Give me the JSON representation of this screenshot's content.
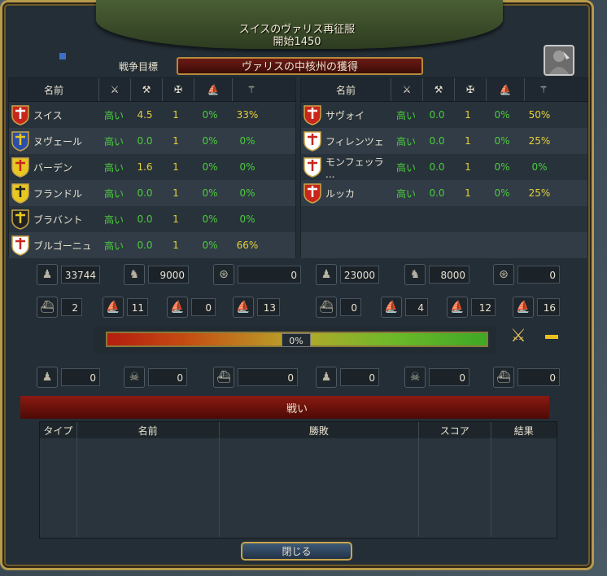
{
  "window": {
    "title": "スイスのヴァリス再征服",
    "subtitle": "開始1450",
    "goal_label": "戦争目標",
    "goal_value": "ヴァリスの中核州の獲得"
  },
  "table_headers": {
    "name": "名前"
  },
  "attackers": [
    {
      "name": "スイス",
      "v1": "高い",
      "v2": "4.5",
      "v3": "1",
      "v4": "0%",
      "v5": "33%"
    },
    {
      "name": "ヌヴェール",
      "v1": "高い",
      "v2": "0.0",
      "v3": "1",
      "v4": "0%",
      "v5": "0%"
    },
    {
      "name": "バーデン",
      "v1": "高い",
      "v2": "1.6",
      "v3": "1",
      "v4": "0%",
      "v5": "0%"
    },
    {
      "name": "フランドル",
      "v1": "高い",
      "v2": "0.0",
      "v3": "1",
      "v4": "0%",
      "v5": "0%"
    },
    {
      "name": "ブラバント",
      "v1": "高い",
      "v2": "0.0",
      "v3": "1",
      "v4": "0%",
      "v5": "0%"
    },
    {
      "name": "ブルゴーニュ",
      "v1": "高い",
      "v2": "0.0",
      "v3": "1",
      "v4": "0%",
      "v5": "66%"
    }
  ],
  "defenders": [
    {
      "name": "サヴォイ",
      "v1": "高い",
      "v2": "0.0",
      "v3": "1",
      "v4": "0%",
      "v5": "50%"
    },
    {
      "name": "フィレンツェ",
      "v1": "高い",
      "v2": "0.0",
      "v3": "1",
      "v4": "0%",
      "v5": "25%"
    },
    {
      "name": "モンフェッラ ...",
      "v1": "高い",
      "v2": "0.0",
      "v3": "1",
      "v4": "0%",
      "v5": "0%"
    },
    {
      "name": "ルッカ",
      "v1": "高い",
      "v2": "0.0",
      "v3": "1",
      "v4": "0%",
      "v5": "25%"
    }
  ],
  "forces": {
    "left": {
      "infantry": "33744",
      "cavalry": "9000",
      "artillery": "0",
      "heavy": "2",
      "light": "11",
      "galley": "0",
      "transport": "13",
      "loss_inf": "0",
      "loss_cav": "0",
      "loss_ship": "0"
    },
    "right": {
      "infantry": "23000",
      "cavalry": "8000",
      "artillery": "0",
      "heavy": "0",
      "light": "4",
      "galley": "12",
      "transport": "16",
      "loss_inf": "0",
      "loss_cav": "0",
      "loss_ship": "0"
    }
  },
  "warscore": {
    "value": "0%",
    "fraction": 0.5
  },
  "battles": {
    "title": "戦い",
    "headers": {
      "type": "タイプ",
      "name": "名前",
      "result_wl": "勝敗",
      "score": "スコア",
      "result": "結果"
    }
  },
  "close_label": "閉じる",
  "colors": {
    "green": "#4ccd3c",
    "yellow": "#e5d03a"
  }
}
